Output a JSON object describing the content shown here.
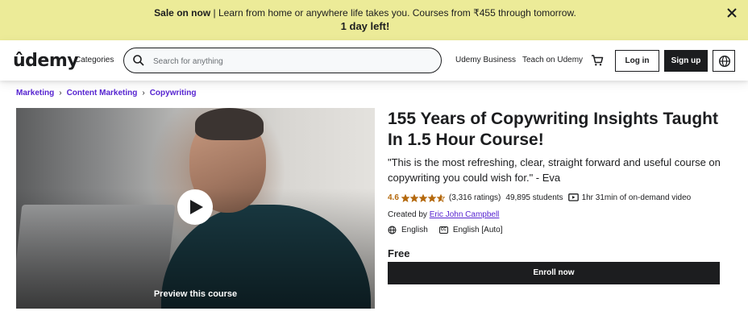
{
  "banner": {
    "sale_label": "Sale on now",
    "sale_text": " | Learn from home or anywhere life takes you. Courses from ₹455 through tomorrow.",
    "countdown": "1 day left!"
  },
  "header": {
    "logo": "ûdemy",
    "categories": "Categories",
    "search_placeholder": "Search for anything",
    "udemy_business": "Udemy Business",
    "teach": "Teach on Udemy",
    "login": "Log in",
    "signup": "Sign up"
  },
  "breadcrumb": {
    "items": [
      "Marketing",
      "Content Marketing",
      "Copywriting"
    ],
    "separator": "›"
  },
  "preview": {
    "label": "Preview this course"
  },
  "course": {
    "title": "155 Years of Copywriting Insights Taught In 1.5 Hour Course!",
    "quote": "\"This is the most refreshing, clear, straight forward and useful course on copywriting you could wish for.\" - Eva",
    "rating": "4.6",
    "rating_value": 4.6,
    "ratings_count": "(3,316 ratings)",
    "students": "49,895 students",
    "duration": "1hr 31min of on-demand video",
    "created_by_label": "Created by ",
    "instructor": "Eric John Campbell",
    "language": "English",
    "captions": "English [Auto]",
    "price": "Free",
    "enroll": "Enroll now"
  },
  "colors": {
    "banner_bg": "#eceb98",
    "brand_purple": "#5624d0",
    "rating_orange": "#b4690e",
    "dark": "#1c1d1f"
  },
  "icons": [
    "close-icon",
    "search-icon",
    "cart-icon",
    "globe-icon",
    "play-icon",
    "star-icon",
    "video-icon",
    "captions-icon"
  ]
}
